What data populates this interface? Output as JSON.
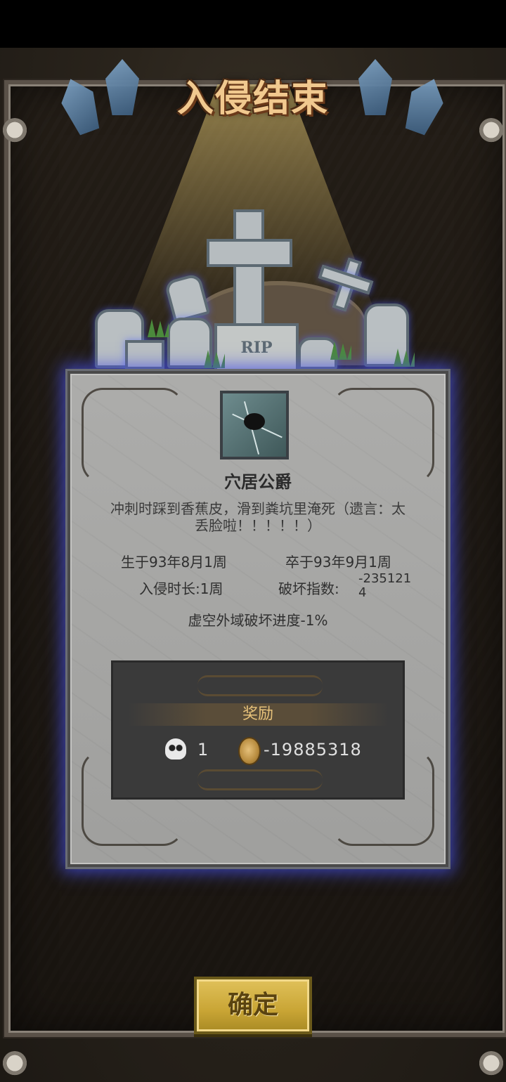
{
  "title": "入侵结束",
  "tombstone": {
    "engraving": "RIP"
  },
  "hero": {
    "name": "穴居公爵",
    "death_description": "冲刺时踩到香蕉皮，滑到粪坑里淹死（遗言：太丢脸啦！！！！！）",
    "born": "生于93年8月1周",
    "died": "卒于93年9月1周",
    "invasion_duration": "入侵时长:1周",
    "damage_index_label": "破坏指数:",
    "damage_index_value": "-2351214",
    "void_progress": "虚空外域破坏进度-1%",
    "portrait_icon": "cracked-spider-portrait"
  },
  "rewards": {
    "header": "奖励",
    "skull_count": "1",
    "skull_icon": "horned-skull-icon",
    "coin_amount": "-19885318",
    "coin_icon": "gold-coin-icon"
  },
  "confirm_button": {
    "label": "确定"
  },
  "colors": {
    "panel_glow": "#4650e6",
    "button_gold": "#c9a535",
    "title_orange": "#f1c98f"
  }
}
